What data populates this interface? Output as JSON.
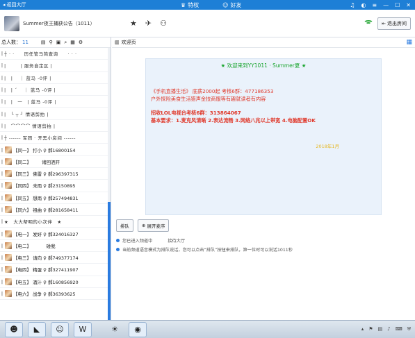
{
  "topbar": {
    "back_label": "返回大厅",
    "nav_privilege": "特权",
    "nav_friends": "好友",
    "bg_color": "#1e7fd6"
  },
  "room": {
    "name": "Summer夜王捕获公告（1011）",
    "exit_label": "退出房间"
  },
  "left": {
    "count_label": "总人数：",
    "count_value": "11",
    "users": [
      {
        "text": "┼ · ·　　历任管马简查询　　· · ·",
        "avatar": false
      },
      {
        "text": "|　　　| 服务自定区 |",
        "avatar": false
      },
      {
        "text": "|　| 　｜ 蓝马 -0评 |",
        "avatar": false
      },
      {
        "text": "|　| ´ 　｜ 蓝马 -0评 |",
        "avatar": false
      },
      {
        "text": "|　|　一　| 蓝马 -0评 |",
        "avatar": false
      },
      {
        "text": "|　└ ┬ ┘ 情语剪拍 |",
        "avatar": false
      },
      {
        "text": "|　⌒⌒⌒⌒ 情语剪拍 |",
        "avatar": false
      },
      {
        "text": "┼ ------ 军团 · 开黑小房间 ------",
        "avatar": false
      },
      {
        "text": "【同一】 打小 ♀ 郝16800154",
        "avatar": true
      },
      {
        "text": "【同二】 　　诸回洒开",
        "avatar": true
      },
      {
        "text": "【同三】 佛雷 ♀ 郝296397315",
        "avatar": true
      },
      {
        "text": "【同四】 未雨 ♀ 郝23150895",
        "avatar": true
      },
      {
        "text": "【同五】 想雨 ♀ 郝257494831",
        "avatar": true
      },
      {
        "text": "【同六】 祖曲 ♀ 郝281658411",
        "avatar": true
      },
      {
        "text": "★　大大帮明的小次伴　★",
        "avatar": false
      },
      {
        "text": "【电一】 发好 ♀ 郝324016327",
        "avatar": true
      },
      {
        "text": "【电二】 　　　碰我",
        "avatar": true
      },
      {
        "text": "【电三】 请向 ♀ 郝749377174",
        "avatar": true
      },
      {
        "text": "【电四】 精蛋 ♀ 郝327411907",
        "avatar": true
      },
      {
        "text": "【电五】 酒汁 ♀ 郝160856920",
        "avatar": true
      },
      {
        "text": "【电六】 战争 ♀ 郝36393625",
        "avatar": true
      }
    ]
  },
  "right": {
    "tab_label": "欢迎页",
    "welcome": "★ 欢迎来到YY1011 · Summer夏 ★",
    "ann_line1": "《手机直播生活》 底薪2000起 考核6群：477186353",
    "ann_line2": "户外探险美食生活猎声金技商服等有趣就读者有内容",
    "ann_line3": "招收LOL电视台考核6群：313864067",
    "ann_line4": "基本要求：1.麦克风清晰 2.表达流畅 3.网络八兆以上带宽 4.电脑配置OK",
    "ann_sign": "2018年1月",
    "btn_queue": "排队",
    "btn_expand": "展开麦序",
    "msg1_a": "您已进入频道中",
    "msg1_b": "接待大厅",
    "msg2": "当前频道语音模式为排队说话，您可以点击“排队”按钮来排队，第一位时可以说话1011秒"
  }
}
